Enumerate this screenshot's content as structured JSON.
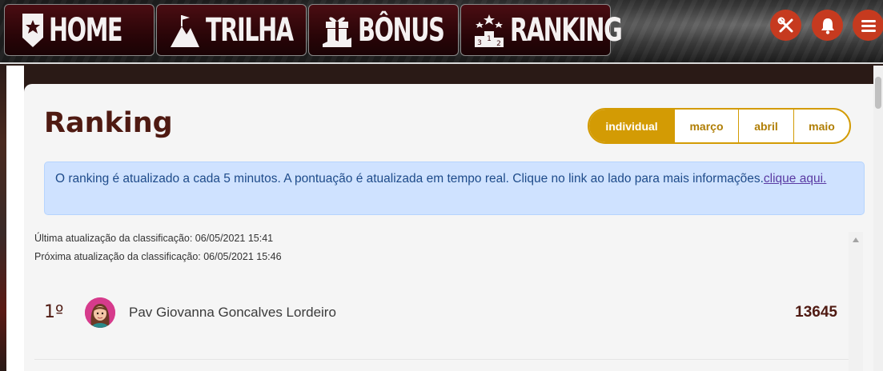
{
  "nav": {
    "tabs": [
      {
        "label": "HOME",
        "icon": "badge-star-icon"
      },
      {
        "label": "TRILHA",
        "icon": "mountain-flag-icon"
      },
      {
        "label": "BÔNUS",
        "icon": "gift-hand-icon"
      },
      {
        "label": "RANKING",
        "icon": "podium-icon"
      }
    ],
    "actions": [
      {
        "icon": "tools-icon"
      },
      {
        "icon": "bell-icon"
      },
      {
        "icon": "menu-icon"
      }
    ]
  },
  "page": {
    "title": "Ranking",
    "filters": [
      {
        "label": "individual",
        "active": true
      },
      {
        "label": "março",
        "active": false
      },
      {
        "label": "abril",
        "active": false
      },
      {
        "label": "maio",
        "active": false
      }
    ],
    "alert": {
      "text": "O ranking é atualizado a cada 5 minutos. A pontuação é atualizada em tempo real. Clique no link ao lado para mais informações.",
      "link": "clique aqui."
    },
    "last_update": "Última atualização da classificação: 06/05/2021 15:41",
    "next_update": "Próxima atualização da classificação: 06/05/2021 15:46"
  },
  "ranking": [
    {
      "position": "1º",
      "name": "Pav Giovanna Goncalves Lordeiro",
      "score": "13645"
    }
  ],
  "colors": {
    "accent": "#d39b04",
    "brand_dark": "#4f1a12",
    "action": "#c63a1f",
    "alert_bg": "#cfe2ff"
  }
}
